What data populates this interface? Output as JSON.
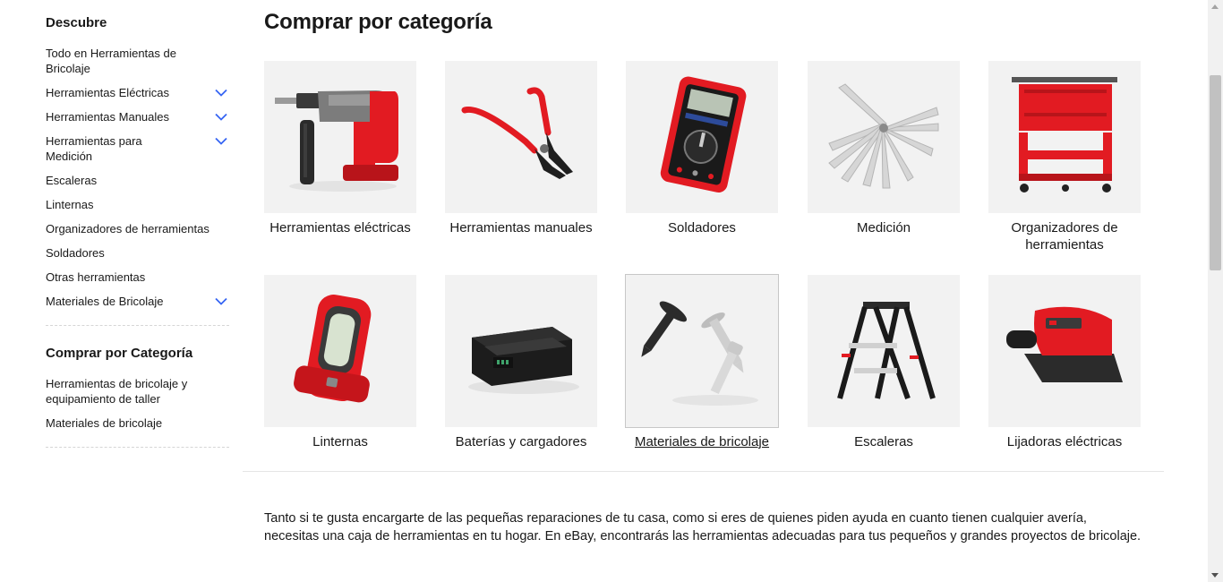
{
  "sidebar": {
    "discover_heading": "Descubre",
    "items": [
      {
        "label": "Todo en Herramientas de Bricolaje",
        "expandable": false
      },
      {
        "label": "Herramientas Eléctricas",
        "expandable": true
      },
      {
        "label": "Herramientas Manuales",
        "expandable": true
      },
      {
        "label": "Herramientas para Medición",
        "expandable": true
      },
      {
        "label": "Escaleras",
        "expandable": false
      },
      {
        "label": "Linternas",
        "expandable": false
      },
      {
        "label": "Organizadores de herramientas",
        "expandable": false
      },
      {
        "label": "Soldadores",
        "expandable": false
      },
      {
        "label": "Otras herramientas",
        "expandable": false
      },
      {
        "label": "Materiales de Bricolaje",
        "expandable": true
      }
    ],
    "category_heading": "Comprar por Categoría",
    "category_items": [
      {
        "label": "Herramientas de bricolaje y equipamiento de taller"
      },
      {
        "label": "Materiales de bricolaje"
      }
    ]
  },
  "main": {
    "title": "Comprar por categoría",
    "tiles": [
      {
        "label": "Herramientas eléctricas",
        "icon": "rotary-hammer-drill"
      },
      {
        "label": "Herramientas manuales",
        "icon": "pliers"
      },
      {
        "label": "Soldadores",
        "icon": "multimeter"
      },
      {
        "label": "Medición",
        "icon": "feeler-gauge"
      },
      {
        "label": "Organizadores de herramientas",
        "icon": "tool-cart"
      },
      {
        "label": "Linternas",
        "icon": "work-light"
      },
      {
        "label": "Baterías y cargadores",
        "icon": "battery-pack"
      },
      {
        "label": "Materiales de bricolaje",
        "icon": "screws",
        "selected": true
      },
      {
        "label": "Escaleras",
        "icon": "step-ladder"
      },
      {
        "label": "Lijadoras eléctricas",
        "icon": "detail-sander"
      }
    ],
    "description": "Tanto si te gusta encargarte de las pequeñas reparaciones de tu casa, como si eres de quienes piden ayuda en cuanto tienen cualquier avería, necesitas una caja de herramientas en tu hogar. En eBay, encontrarás las herramientas adecuadas para tus pequeños y grandes proyectos de bricolaje."
  },
  "colors": {
    "accent_chevron": "#3665f3",
    "tool_red": "#e21b22",
    "tile_bg": "#f2f2f2"
  }
}
